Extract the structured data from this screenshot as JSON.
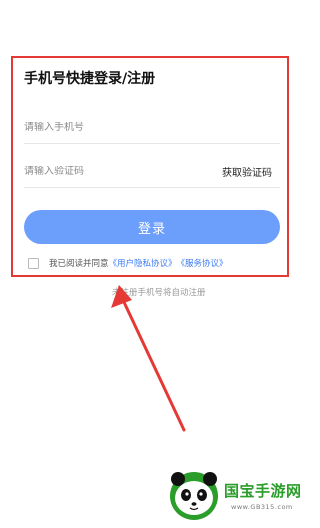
{
  "login": {
    "title": "手机号快捷登录/注册",
    "phone_placeholder": "请输入手机号",
    "code_placeholder": "请输入验证码",
    "get_code_label": "获取验证码",
    "login_button_label": "登录",
    "agree_prefix": "我已阅读并同意",
    "privacy_link": "《用户隐私协议》",
    "service_link": "《服务协议》",
    "auto_register_note": "未注册手机号将自动注册"
  },
  "watermark": {
    "name": "国宝手游网",
    "url": "www.GB315.com"
  },
  "colors": {
    "accent_button": "#6c9ffc",
    "link": "#3b7bf5",
    "annotation": "#e53935",
    "brand_green": "#2a9d2a"
  }
}
